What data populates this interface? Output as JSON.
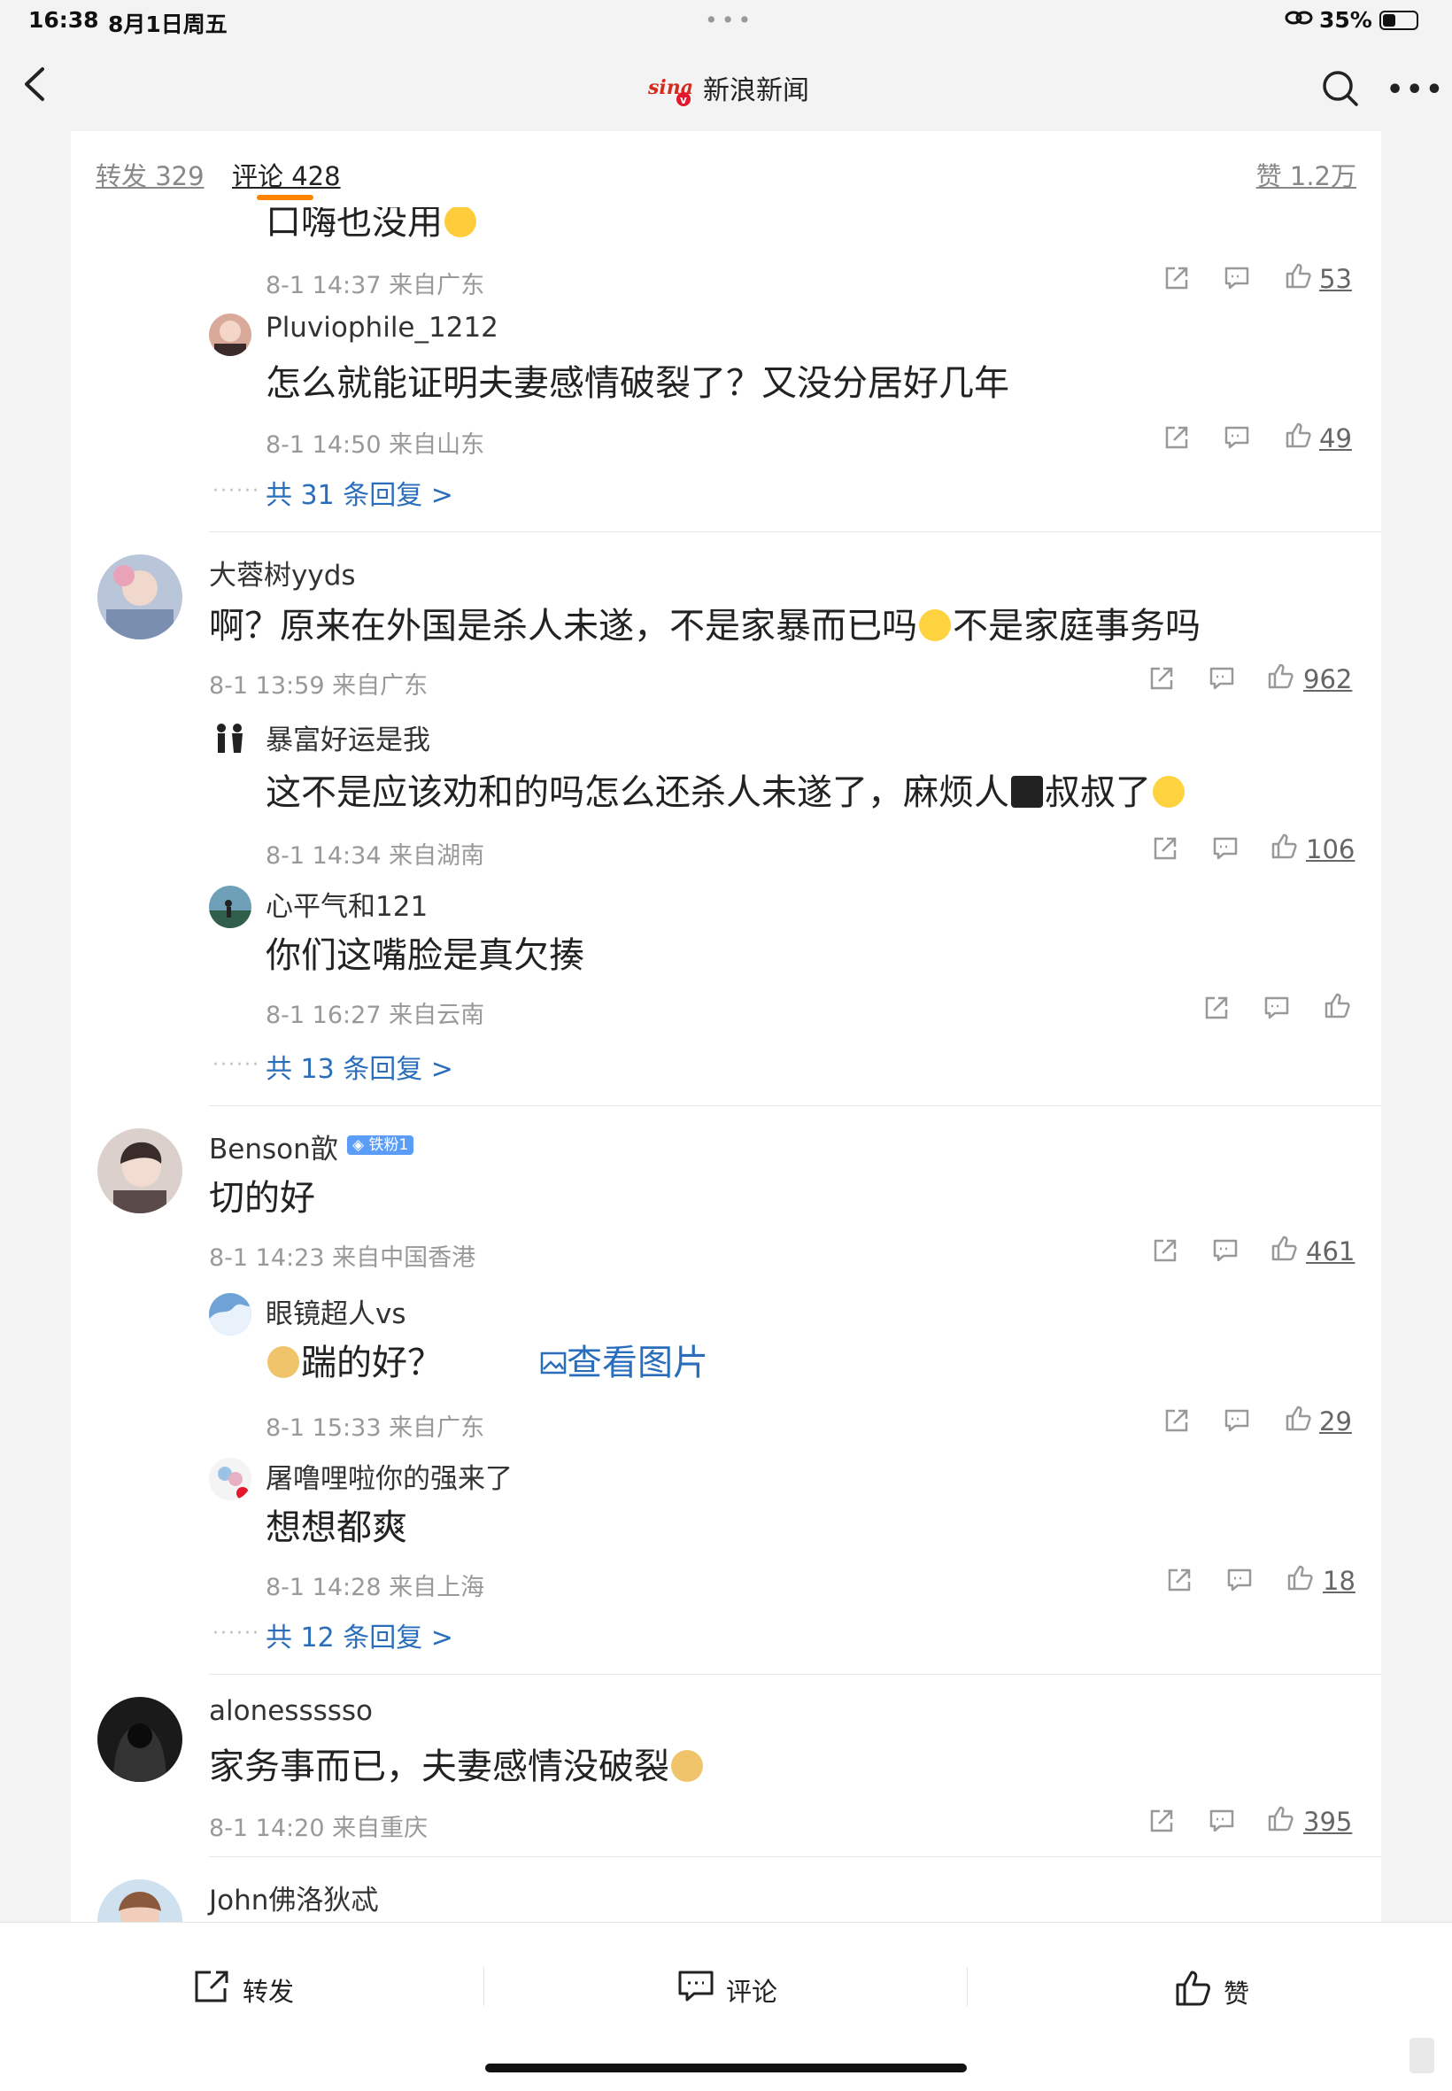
{
  "status_bar": {
    "time": "16:38",
    "date": "8月1日周五",
    "dots": "•••",
    "battery": "35%"
  },
  "nav": {
    "title": "新浪新闻"
  },
  "tabs": {
    "repost": "转发 329",
    "comment": "评论 428",
    "like": "赞 1.2万"
  },
  "comments": [
    {
      "partial_text": "口嗨也没用",
      "meta": "8-1 14:37 来自广东",
      "likes": "53",
      "replies": [
        {
          "name": "Pluviophile_1212",
          "text": "怎么就能证明夫妻感情破裂了？又没分居好几年",
          "meta": "8-1 14:50 来自山东",
          "likes": "49"
        }
      ],
      "more_replies": "共 31 条回复 >"
    },
    {
      "name": "大蓉树yyds",
      "text_a": "啊？原来在外国是杀人未遂，不是家暴而已吗",
      "text_b": "不是家庭事务吗",
      "meta": "8-1 13:59 来自广东",
      "likes": "962",
      "replies": [
        {
          "name": "暴富好运是我",
          "text_a": "这不是应该劝和的吗怎么还杀人未遂了，麻烦人",
          "text_b": "叔叔了",
          "meta": "8-1 14:34 来自湖南",
          "likes": "106"
        },
        {
          "name": "心平气和121",
          "text": "你们这嘴脸是真欠揍",
          "meta": "8-1 16:27 来自云南",
          "likes": ""
        }
      ],
      "more_replies": "共 13 条回复 >"
    },
    {
      "name": "Benson歆",
      "badge": "◈ 铁粉1",
      "text": "切的好",
      "meta": "8-1 14:23 来自中国香港",
      "likes": "461",
      "replies": [
        {
          "name": "眼镜超人vs",
          "text": "踹的好？",
          "link": "查看图片",
          "meta": "8-1 15:33 来自广东",
          "likes": "29"
        },
        {
          "name": "屠噜哩啦你的强来了",
          "text": "想想都爽",
          "meta": "8-1 14:28 来自上海",
          "likes": "18"
        }
      ],
      "more_replies": "共 12 条回复 >"
    },
    {
      "name": "alonessssso",
      "text": "家务事而已，夫妻感情没破裂",
      "meta": "8-1 14:20 来自重庆",
      "likes": "395"
    },
    {
      "name": "John佛洛狄忒"
    }
  ],
  "bottom_bar": {
    "repost": "转发",
    "comment": "评论",
    "like": "赞"
  },
  "colors": {
    "accent": "#ff8200",
    "link": "#2a6ebb",
    "muted": "#999999"
  },
  "icons": [
    "back-icon",
    "sina-logo-icon",
    "search-icon",
    "more-icon",
    "share-icon",
    "comment-icon",
    "like-icon",
    "image-icon"
  ]
}
